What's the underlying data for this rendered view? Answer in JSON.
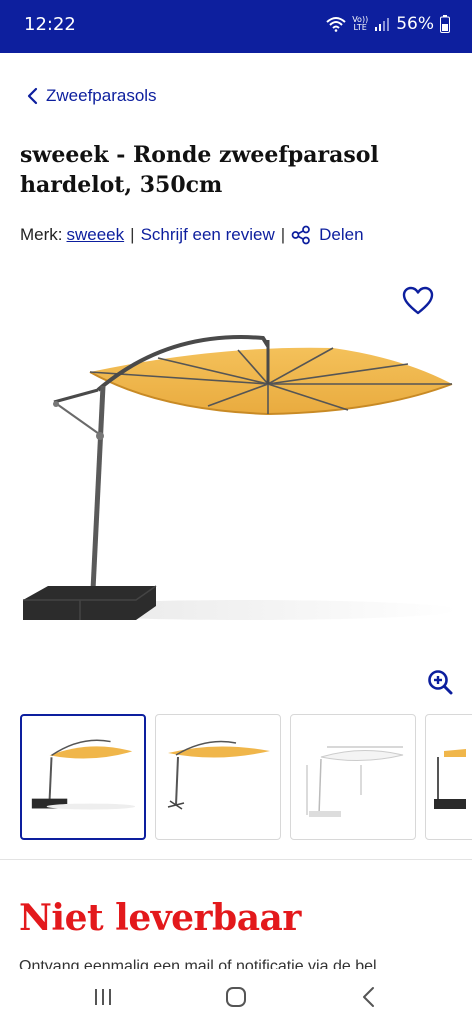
{
  "status_bar": {
    "time": "12:22",
    "network_top": "Vo))",
    "network_bottom": "LTE",
    "battery": "56%",
    "icons": [
      "wifi-icon",
      "signal-icon",
      "battery-icon"
    ]
  },
  "breadcrumb": {
    "label": "Zweefparasols",
    "icon": "chevron-left-icon"
  },
  "product": {
    "title": "sweeek - Ronde zweefparasol hardelot, 350cm",
    "brand_label": "Merk:",
    "brand": "sweeek",
    "separator": "|",
    "review_link": "Schrijf een review",
    "share_label": "Delen"
  },
  "gallery": {
    "favorite_icon": "heart-icon",
    "zoom_icon": "zoom-in-icon",
    "thumbnails": [
      {
        "name": "thumbnail-1",
        "active": true
      },
      {
        "name": "thumbnail-2",
        "active": false
      },
      {
        "name": "thumbnail-3",
        "active": false
      },
      {
        "name": "thumbnail-4",
        "active": false
      }
    ]
  },
  "availability": {
    "status": "Niet leverbaar",
    "notify_text": "Ontvang eenmalig een mail of notificatie via de bel"
  },
  "colors": {
    "brand_blue": "#0d1f9e",
    "alert_red": "#e3191c",
    "canopy_yellow": "#f0b64a"
  },
  "navbar": {
    "icons": [
      "recent-apps-icon",
      "home-icon",
      "back-icon"
    ]
  }
}
